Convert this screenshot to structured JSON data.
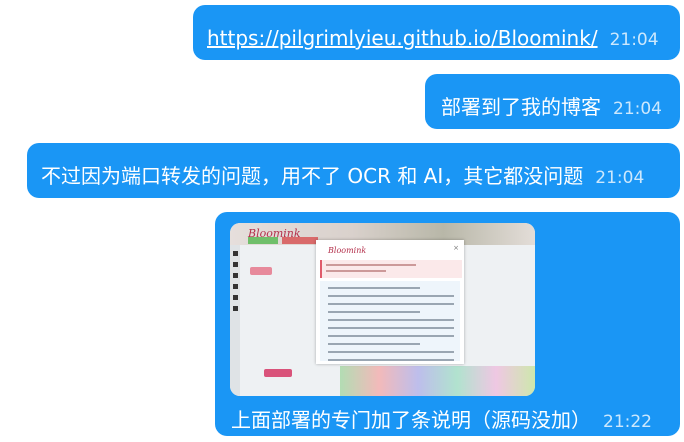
{
  "messages": [
    {
      "text": "https://pilgrimlyieu.github.io/Bloomink/",
      "time": "21:04"
    },
    {
      "text": "部署到了我的博客",
      "time": "21:04"
    },
    {
      "text": "不过因为端口转发的问题，用不了 OCR 和 AI，其它都没问题",
      "time": "21:04"
    },
    {
      "text": "上面部署的专门加了条说明（源码没加）",
      "time": "21:22"
    }
  ],
  "screenshot": {
    "brand": "Bloomink",
    "dialog_title": "Bloomink",
    "dialog_close": "×"
  },
  "colors": {
    "bubble": "#1a96f5",
    "text": "#ffffff"
  }
}
